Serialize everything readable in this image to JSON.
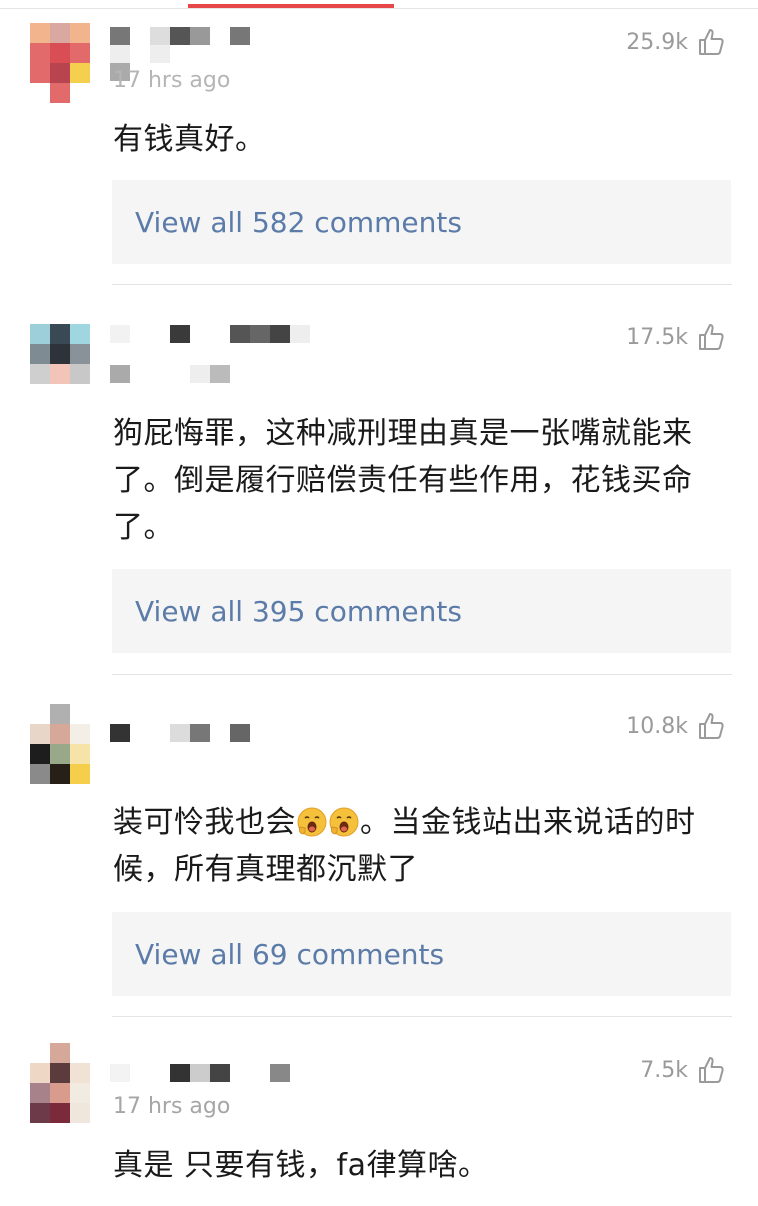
{
  "colors": {
    "accent": "#e8474a",
    "link": "#5b7ba8",
    "muted": "#a6a6a6",
    "text": "#1a1a1a",
    "reply_bg": "#f5f5f5"
  },
  "comments": [
    {
      "likes": "25.9k",
      "timestamp": "17 hrs ago",
      "text": "有钱真好。",
      "replies_label": "View all 582 comments"
    },
    {
      "likes": "17.5k",
      "timestamp": "",
      "text": "狗屁悔罪，这种减刑理由真是一张嘴就能来了。倒是履行赔偿责任有些作用，花钱买命了。",
      "replies_label": "View all 395 comments"
    },
    {
      "likes": "10.8k",
      "timestamp": "",
      "text_before_emoji": "装可怜我也会",
      "text_after_emoji": "。当金钱站出来说话的时候，所有真理都沉默了",
      "emoji_icon": "yawning-face-emoji",
      "replies_label": "View all 69 comments"
    },
    {
      "likes": "7.5k",
      "timestamp": "17 hrs ago",
      "text": "真是 只要有钱，fa律算啥。"
    }
  ]
}
